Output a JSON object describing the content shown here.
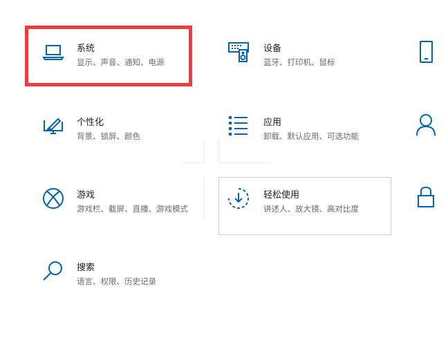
{
  "accent_color": "#0063b1",
  "highlight_color": "#ef3b3f",
  "tiles": {
    "system": {
      "title": "系统",
      "subtitle": "显示、声音、通知、电源",
      "icon": "laptop-icon"
    },
    "devices": {
      "title": "设备",
      "subtitle": "蓝牙、打印机、鼠标",
      "icon": "keyboard-speaker-icon"
    },
    "personalization": {
      "title": "个性化",
      "subtitle": "背景、锁屏、颜色",
      "icon": "paint-monitor-icon"
    },
    "apps": {
      "title": "应用",
      "subtitle": "卸载、默认应用、可选功能",
      "icon": "app-list-icon"
    },
    "gaming": {
      "title": "游戏",
      "subtitle": "游戏栏、截屏、直播、游戏模式",
      "icon": "xbox-icon"
    },
    "ease": {
      "title": "轻松使用",
      "subtitle": "讲述人、放大镜、高对比度",
      "icon": "ease-of-access-icon"
    },
    "search": {
      "title": "搜索",
      "subtitle": "语言、权限、历史记录",
      "icon": "search-icon"
    }
  },
  "side_icons": [
    "phone-icon",
    "person-icon",
    "lock-icon"
  ]
}
